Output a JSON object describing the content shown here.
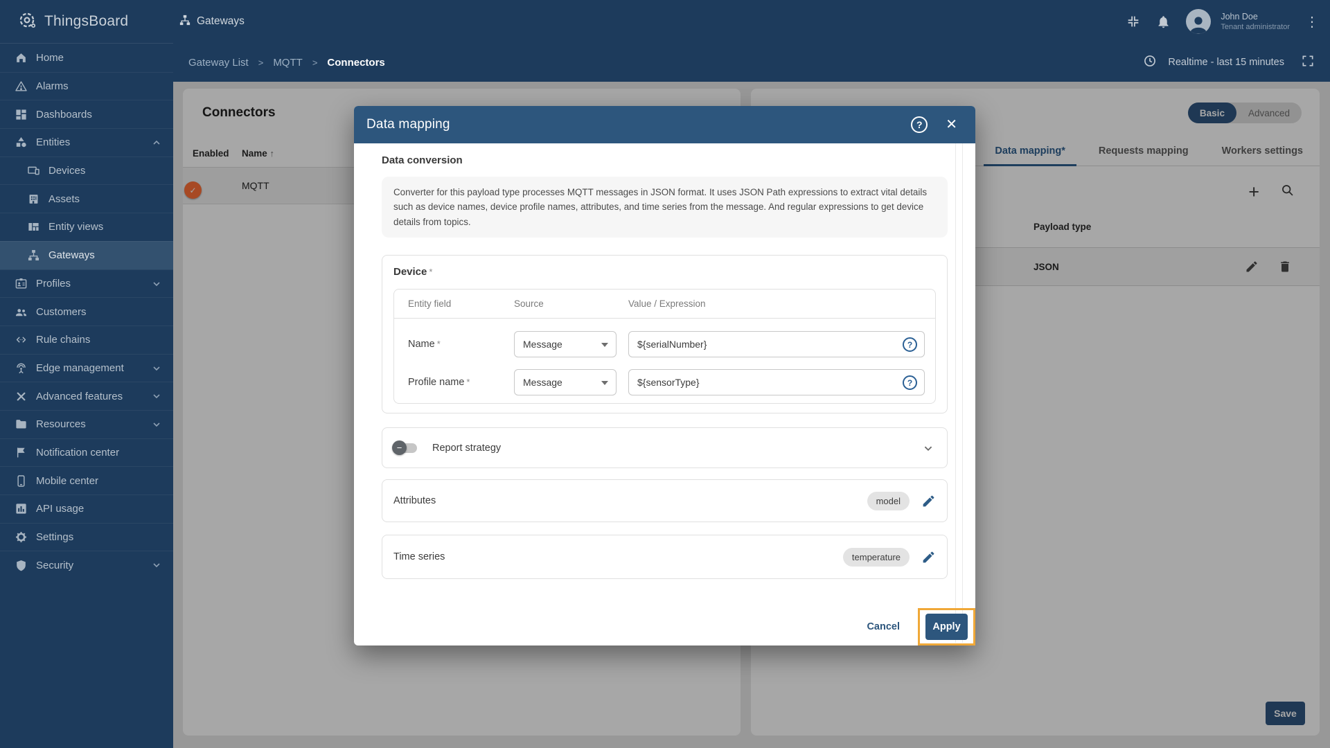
{
  "topbar": {
    "brand": "ThingsBoard",
    "page_title": "Gateways",
    "user_name": "John Doe",
    "user_role": "Tenant administrator"
  },
  "breadcrumb": {
    "items": [
      "Gateway List",
      "MQTT",
      "Connectors"
    ],
    "sep": ">",
    "time_range": "Realtime - last 15 minutes"
  },
  "sidebar": {
    "items": [
      {
        "label": "Home"
      },
      {
        "label": "Alarms"
      },
      {
        "label": "Dashboards"
      },
      {
        "label": "Entities"
      },
      {
        "label": "Devices"
      },
      {
        "label": "Assets"
      },
      {
        "label": "Entity views"
      },
      {
        "label": "Gateways"
      },
      {
        "label": "Profiles"
      },
      {
        "label": "Customers"
      },
      {
        "label": "Rule chains"
      },
      {
        "label": "Edge management"
      },
      {
        "label": "Advanced features"
      },
      {
        "label": "Resources"
      },
      {
        "label": "Notification center"
      },
      {
        "label": "Mobile center"
      },
      {
        "label": "API usage"
      },
      {
        "label": "Settings"
      },
      {
        "label": "Security"
      }
    ]
  },
  "connectors": {
    "title": "Connectors",
    "col_enabled": "Enabled",
    "col_name": "Name",
    "rows": [
      {
        "name": "MQTT",
        "enabled": true
      }
    ]
  },
  "config": {
    "mode_basic": "Basic",
    "mode_advanced": "Advanced",
    "active_mode": "Basic",
    "tabs": [
      "Data mapping*",
      "Requests mapping",
      "Workers settings"
    ],
    "active_tab": "Data mapping*",
    "payload_col": "Payload type",
    "rows": [
      {
        "type": "JSON"
      }
    ],
    "save_label": "Save"
  },
  "modal": {
    "title": "Data mapping",
    "section_heading": "Data conversion",
    "description": "Converter for this payload type processes MQTT messages in JSON format. It uses JSON Path expressions to extract vital details such as device names, device profile names, attributes, and time series from the message. And regular expressions to get device details from topics.",
    "device": {
      "heading": "Device",
      "req": "*",
      "columns": [
        "Entity field",
        "Source",
        "Value / Expression"
      ],
      "rows": [
        {
          "field": "Name",
          "req": "*",
          "source": "Message",
          "value": "${serialNumber}"
        },
        {
          "field": "Profile name",
          "req": "*",
          "source": "Message",
          "value": "${sensorType}"
        }
      ]
    },
    "report_strategy": {
      "label": "Report strategy",
      "enabled": false
    },
    "attributes": {
      "label": "Attributes",
      "chip": "model"
    },
    "time_series": {
      "label": "Time series",
      "chip": "temperature"
    },
    "footer": {
      "cancel": "Cancel",
      "apply": "Apply"
    }
  },
  "icons": {
    "help": "?",
    "close": "✕",
    "plus": "+",
    "sort_asc": "↑",
    "more": "⋮",
    "minus": "−",
    "check": "✓"
  },
  "colors": {
    "chrome_navy": "#1d3b5c",
    "primary_blue": "#305680",
    "modal_header_blue": "#2d567d",
    "toggle_on_orange": "#ff7037",
    "highlight_orange": "#f0a838"
  }
}
